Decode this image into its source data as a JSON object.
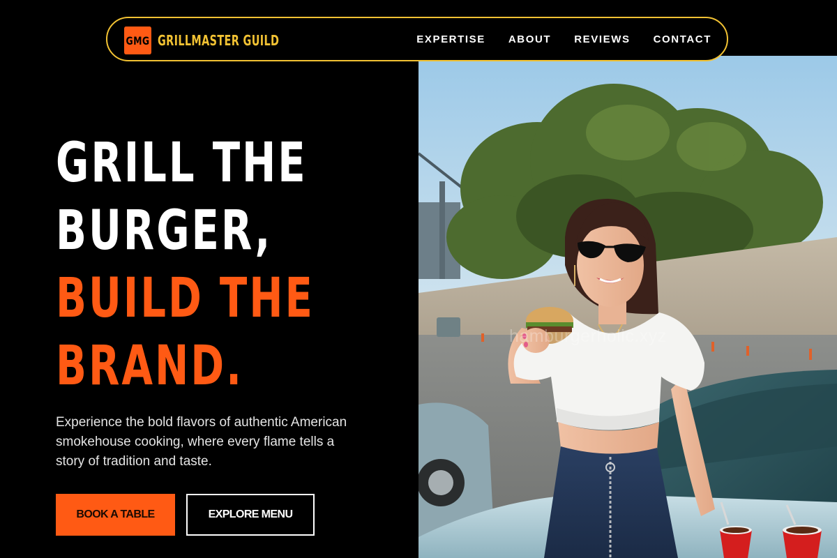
{
  "nav": {
    "logo_mark": "GMG",
    "brand": "GRILLMASTER GUILD",
    "links": [
      "EXPERTISE",
      "ABOUT",
      "REVIEWS",
      "CONTACT"
    ]
  },
  "hero": {
    "headline": {
      "line1": "GRILL THE",
      "line2": "BURGER,",
      "line3": "BUILD THE",
      "line4": "BRAND."
    },
    "lede": "Experience the bold flavors of authentic American smokehouse cooking, where every flame tells a story of tradition and taste.",
    "primary_cta": "BOOK A TABLE",
    "secondary_cta": "EXPLORE MENU",
    "image_watermark": "hamburgerholic.xyz"
  },
  "colors": {
    "accent_orange": "#ff5a14",
    "accent_yellow": "#f2c233",
    "background": "#000000"
  }
}
